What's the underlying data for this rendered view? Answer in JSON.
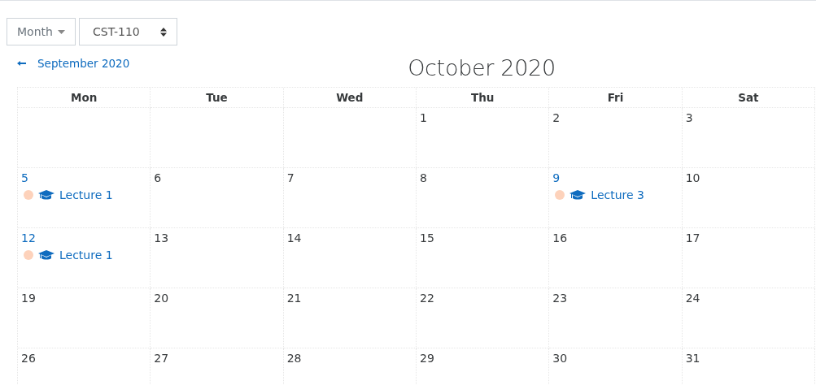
{
  "view_select": {
    "value": "Month"
  },
  "course_select": {
    "value": "CST-110"
  },
  "prev_month": {
    "label": "September 2020"
  },
  "title": "October 2020",
  "columns": [
    "Mon",
    "Tue",
    "Wed",
    "Thu",
    "Fri",
    "Sat"
  ],
  "weeks": [
    [
      {
        "kind": "empty"
      },
      {
        "kind": "empty"
      },
      {
        "kind": "empty"
      },
      {
        "kind": "day",
        "day": "1"
      },
      {
        "kind": "day",
        "day": "2"
      },
      {
        "kind": "day",
        "day": "3"
      }
    ],
    [
      {
        "kind": "day",
        "day": "5",
        "events": [
          {
            "title": "Lecture 1",
            "color": "#fdd2bb"
          }
        ]
      },
      {
        "kind": "day",
        "day": "6"
      },
      {
        "kind": "day",
        "day": "7"
      },
      {
        "kind": "day",
        "day": "8"
      },
      {
        "kind": "day",
        "day": "9",
        "events": [
          {
            "title": "Lecture 3",
            "color": "#fdd2bb"
          }
        ]
      },
      {
        "kind": "day",
        "day": "10"
      }
    ],
    [
      {
        "kind": "day",
        "day": "12",
        "events": [
          {
            "title": "Lecture 1",
            "color": "#fdd2bb"
          }
        ]
      },
      {
        "kind": "day",
        "day": "13"
      },
      {
        "kind": "day",
        "day": "14"
      },
      {
        "kind": "day",
        "day": "15"
      },
      {
        "kind": "day",
        "day": "16"
      },
      {
        "kind": "day",
        "day": "17"
      }
    ],
    [
      {
        "kind": "day",
        "day": "19"
      },
      {
        "kind": "day",
        "day": "20"
      },
      {
        "kind": "day",
        "day": "21"
      },
      {
        "kind": "day",
        "day": "22"
      },
      {
        "kind": "day",
        "day": "23"
      },
      {
        "kind": "day",
        "day": "24"
      }
    ],
    [
      {
        "kind": "day",
        "day": "26"
      },
      {
        "kind": "day",
        "day": "27"
      },
      {
        "kind": "day",
        "day": "28"
      },
      {
        "kind": "day",
        "day": "29"
      },
      {
        "kind": "day",
        "day": "30"
      },
      {
        "kind": "day",
        "day": "31"
      }
    ]
  ]
}
